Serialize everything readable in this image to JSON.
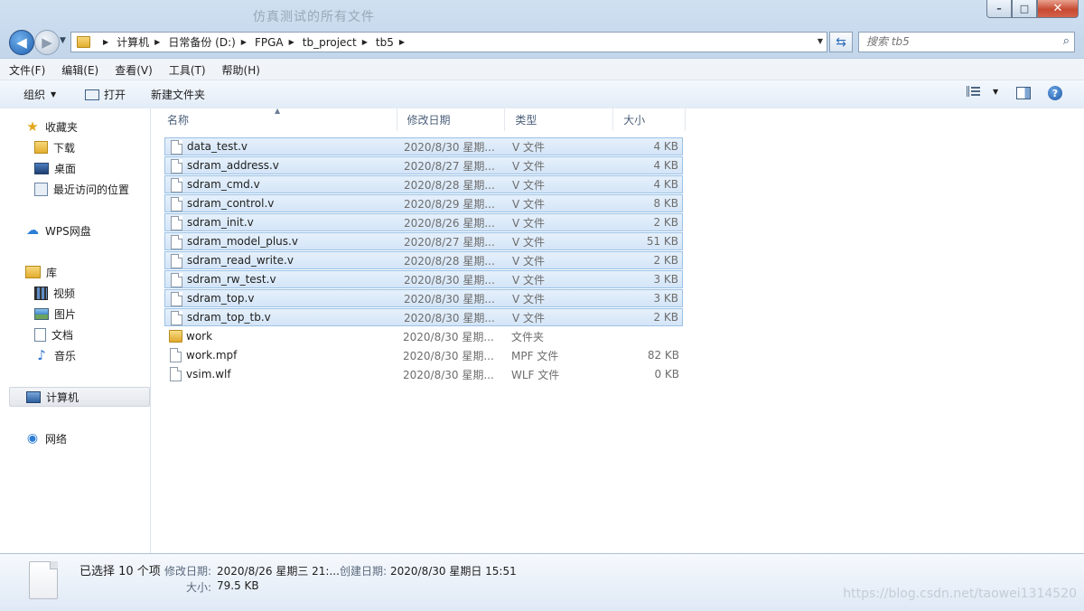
{
  "window": {
    "title": "仿真测试的所有文件",
    "controls": {
      "minimize": "–",
      "maximize": "□",
      "close": "✕"
    }
  },
  "nav": {
    "back": "◀",
    "forward": "▶",
    "dropdown": "▼"
  },
  "address": {
    "crumbs": [
      "计算机",
      "日常备份 (D:)",
      "FPGA",
      "tb_project",
      "tb5"
    ],
    "separator": "▶",
    "dropdown": "▼",
    "refresh": "⇆"
  },
  "search": {
    "placeholder": "搜索 tb5",
    "icon": "search-icon"
  },
  "menu": [
    "文件(F)",
    "编辑(E)",
    "查看(V)",
    "工具(T)",
    "帮助(H)"
  ],
  "toolbar": {
    "organize": "组织",
    "open": "打开",
    "new_folder": "新建文件夹",
    "help": "?"
  },
  "sidebar": {
    "favorites": {
      "label": "收藏夹",
      "items": [
        "下载",
        "桌面",
        "最近访问的位置"
      ]
    },
    "wps": "WPS网盘",
    "libraries": {
      "label": "库",
      "items": [
        "视频",
        "图片",
        "文档",
        "音乐"
      ]
    },
    "computer": "计算机",
    "network": "网络"
  },
  "columns": {
    "name": "名称",
    "date": "修改日期",
    "type": "类型",
    "size": "大小",
    "sort": "▲"
  },
  "files": [
    {
      "name": "data_test.v",
      "date": "2020/8/30 星期...",
      "type": "V 文件",
      "size": "4 KB",
      "selected": true,
      "kind": "file"
    },
    {
      "name": "sdram_address.v",
      "date": "2020/8/27 星期...",
      "type": "V 文件",
      "size": "4 KB",
      "selected": true,
      "kind": "file"
    },
    {
      "name": "sdram_cmd.v",
      "date": "2020/8/28 星期...",
      "type": "V 文件",
      "size": "4 KB",
      "selected": true,
      "kind": "file"
    },
    {
      "name": "sdram_control.v",
      "date": "2020/8/29 星期...",
      "type": "V 文件",
      "size": "8 KB",
      "selected": true,
      "kind": "file"
    },
    {
      "name": "sdram_init.v",
      "date": "2020/8/26 星期...",
      "type": "V 文件",
      "size": "2 KB",
      "selected": true,
      "kind": "file"
    },
    {
      "name": "sdram_model_plus.v",
      "date": "2020/8/27 星期...",
      "type": "V 文件",
      "size": "51 KB",
      "selected": true,
      "kind": "file"
    },
    {
      "name": "sdram_read_write.v",
      "date": "2020/8/28 星期...",
      "type": "V 文件",
      "size": "2 KB",
      "selected": true,
      "kind": "file"
    },
    {
      "name": "sdram_rw_test.v",
      "date": "2020/8/30 星期...",
      "type": "V 文件",
      "size": "3 KB",
      "selected": true,
      "kind": "file"
    },
    {
      "name": "sdram_top.v",
      "date": "2020/8/30 星期...",
      "type": "V 文件",
      "size": "3 KB",
      "selected": true,
      "kind": "file"
    },
    {
      "name": "sdram_top_tb.v",
      "date": "2020/8/30 星期...",
      "type": "V 文件",
      "size": "2 KB",
      "selected": true,
      "kind": "file"
    },
    {
      "name": "work",
      "date": "2020/8/30 星期...",
      "type": "文件夹",
      "size": "",
      "selected": false,
      "kind": "folder"
    },
    {
      "name": "work.mpf",
      "date": "2020/8/30 星期...",
      "type": "MPF 文件",
      "size": "82 KB",
      "selected": false,
      "kind": "file"
    },
    {
      "name": "vsim.wlf",
      "date": "2020/8/30 星期...",
      "type": "WLF 文件",
      "size": "0 KB",
      "selected": false,
      "kind": "file"
    }
  ],
  "status": {
    "selected": "已选择 10 个项",
    "modified_label": "修改日期:",
    "modified_value": "2020/8/26 星期三 21:...",
    "created_label": "创建日期:",
    "created_value": "2020/8/30 星期日 15:51",
    "size_label": "大小:",
    "size_value": "79.5 KB",
    "watermark": "https://blog.csdn.net/taowei1314520"
  }
}
